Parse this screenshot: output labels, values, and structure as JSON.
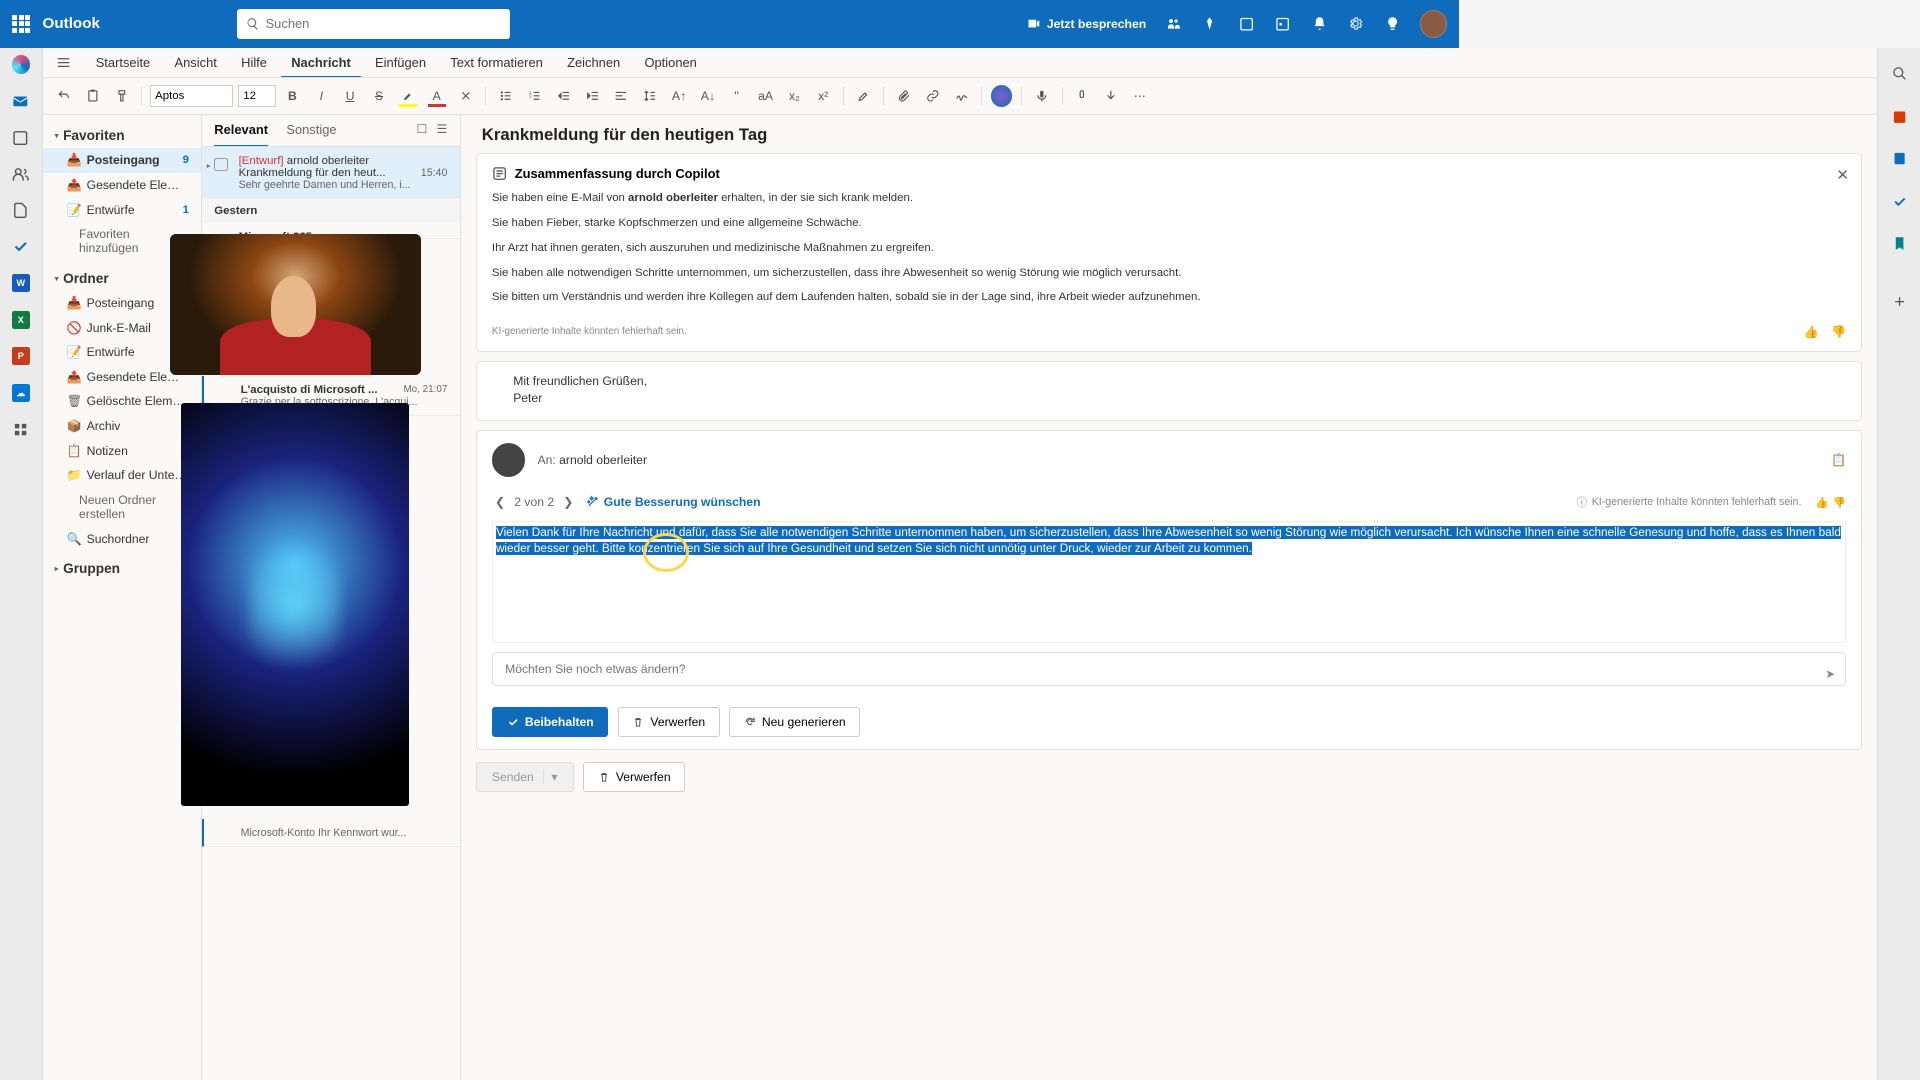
{
  "header": {
    "brand": "Outlook",
    "search_placeholder": "Suchen",
    "meet_now": "Jetzt besprechen"
  },
  "tabs": {
    "home": "Startseite",
    "view": "Ansicht",
    "help": "Hilfe",
    "message": "Nachricht",
    "insert": "Einfügen",
    "format": "Text formatieren",
    "draw": "Zeichnen",
    "options": "Optionen"
  },
  "toolbar": {
    "font": "Aptos",
    "size": "12"
  },
  "nav": {
    "favorites": "Favoriten",
    "inbox": "Posteingang",
    "inbox_count": "9",
    "sent": "Gesendete Elemente",
    "drafts": "Entwürfe",
    "drafts_count": "1",
    "add_fav": "Favoriten hinzufügen",
    "folders": "Ordner",
    "junk": "Junk-E-Mail",
    "deleted": "Gelöschte Elemente",
    "archive": "Archiv",
    "notes": "Notizen",
    "history": "Verlauf der Unterhalt...",
    "new_folder": "Neuen Ordner erstellen",
    "search_folders": "Suchordner",
    "groups": "Gruppen"
  },
  "list": {
    "relevant": "Relevant",
    "other": "Sonstige",
    "item1_from_prefix": "[Entwurf]",
    "item1_from": "arnold oberleiter",
    "item1_subj": "Krankmeldung für den heut...",
    "item1_time": "15:40",
    "item1_preview": "Sehr geehrte Damen und Herren, i...",
    "yesterday": "Gestern",
    "item2_from": "Microsoft 365",
    "item3_subj": "L'acquisto di Microsoft ...",
    "item3_time": "Mo, 21:07",
    "item3_preview": "Grazie per la sottoscrizione. L'acqui...",
    "item4_preview": "Microsoft-Konto Ihr Kennwort wur..."
  },
  "mail": {
    "subject": "Krankmeldung für den heutigen Tag",
    "summary_title": "Zusammenfassung durch Copilot",
    "summary_1a": "Sie haben eine E-Mail von ",
    "summary_1b": "arnold oberleiter",
    "summary_1c": " erhalten, in der sie sich krank melden.",
    "summary_2": "Sie haben Fieber, starke Kopfschmerzen und eine allgemeine Schwäche.",
    "summary_3": "Ihr Arzt hat ihnen geraten, sich auszuruhen und medizinische Maßnahmen zu ergreifen.",
    "summary_4": "Sie haben alle notwendigen Schritte unternommen, um sicherzustellen, dass ihre Abwesenheit so wenig Störung wie möglich verursacht.",
    "summary_5": "Sie bitten um Verständnis und werden ihre Kollegen auf dem Laufenden halten, sobald sie in der Lage sind, ihre Arbeit wieder aufzunehmen.",
    "disclaimer": "KI-generierte Inhalte könnten fehlerhaft sein.",
    "prev_sign": "Mit freundlichen Grüßen,",
    "prev_name": "Peter",
    "to_label": "An:",
    "to_name": "arnold oberleiter",
    "pager": "2 von 2",
    "suggestion": "Gute Besserung wünschen",
    "ai_warn": "KI-generierte Inhalte könnten fehlerhaft sein.",
    "draft": "Vielen Dank für Ihre Nachricht und dafür, dass Sie alle notwendigen Schritte unternommen haben, um sicherzustellen, dass Ihre Abwesenheit so wenig Störung wie möglich verursacht. Ich wünsche Ihnen eine schnelle Genesung und hoffe, dass es Ihnen bald wieder besser geht. Bitte konzentrieren Sie sich auf Ihre Gesundheit und setzen Sie sich nicht unnötig unter Druck, wieder zur Arbeit zu kommen.",
    "refine_placeholder": "Möchten Sie noch etwas ändern?",
    "keep": "Beibehalten",
    "discard": "Verwerfen",
    "regenerate": "Neu generieren",
    "send": "Senden",
    "discard2": "Verwerfen"
  }
}
